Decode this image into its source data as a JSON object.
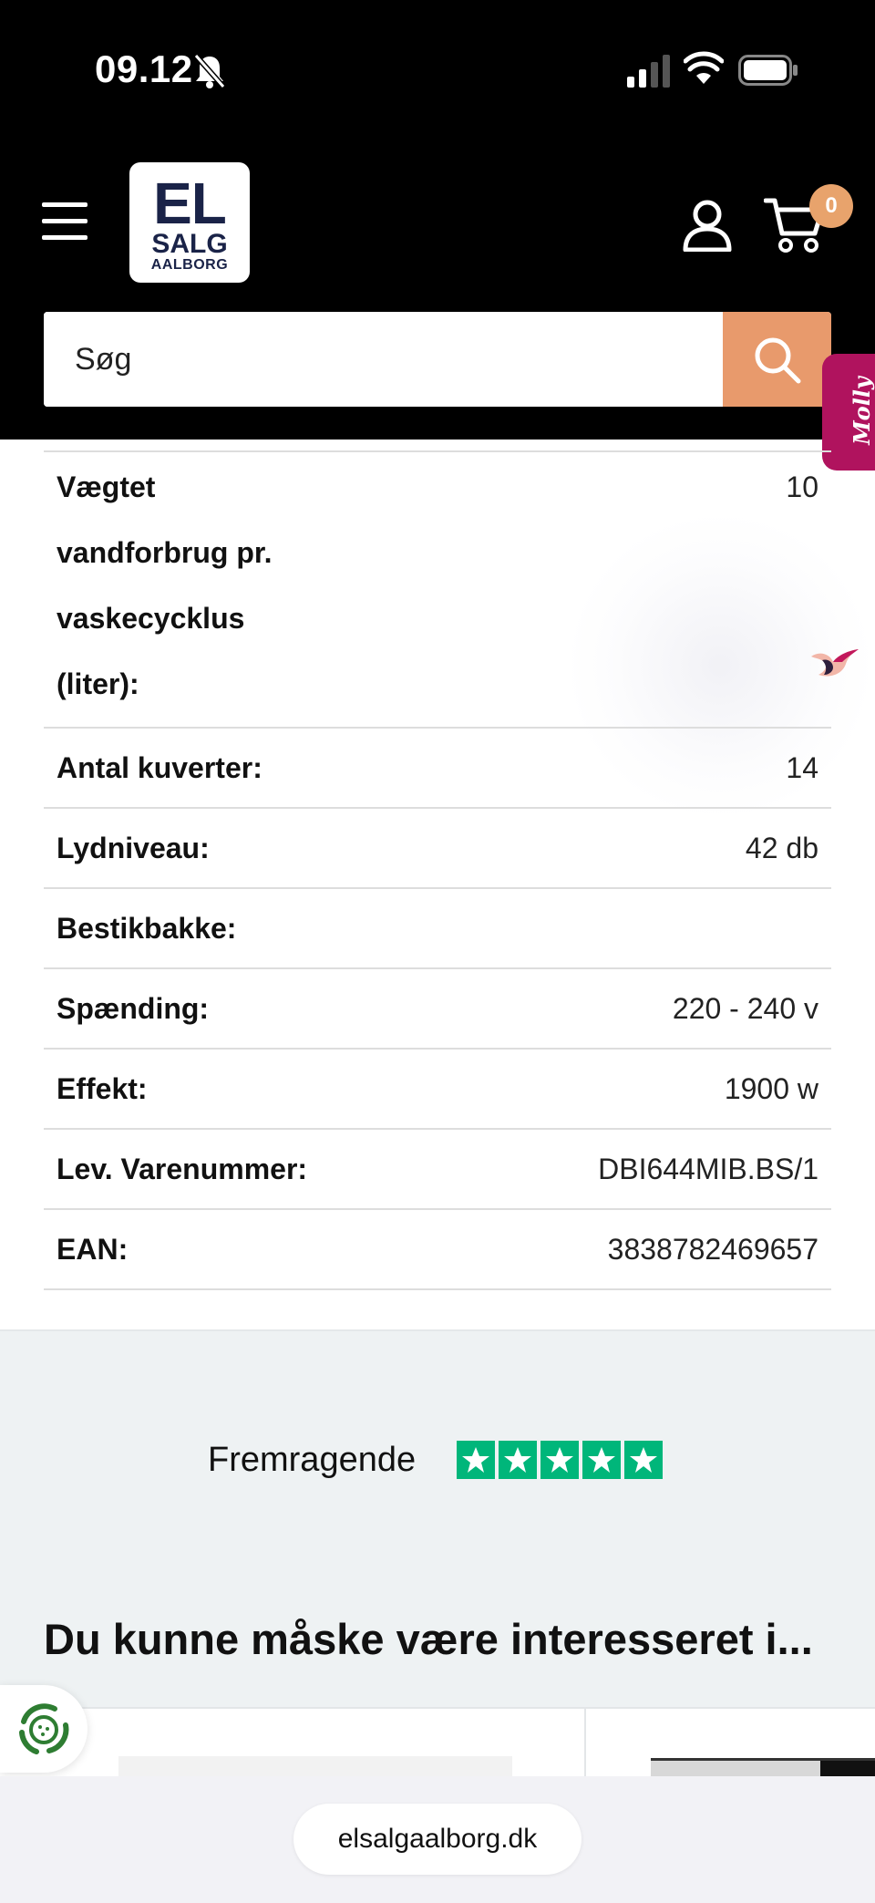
{
  "status_bar": {
    "time": "09.12",
    "icons": [
      "bell-slash-icon",
      "cellular-signal-icon",
      "wifi-icon",
      "battery-icon"
    ]
  },
  "header": {
    "logo": {
      "line1": "EL",
      "line2": "SALG",
      "line3": "AALBORG"
    },
    "cart_count": "0",
    "icons": [
      "menu-icon",
      "account-icon",
      "cart-icon"
    ]
  },
  "search": {
    "placeholder": "Søg",
    "button_icon": "search-icon"
  },
  "molly": {
    "label": "Molly"
  },
  "specs": [
    {
      "label": "Vægtet vandforbrug pr. vaskecycklus (liter):",
      "value": "10"
    },
    {
      "label": "Antal kuverter:",
      "value": "14"
    },
    {
      "label": "Lydniveau:",
      "value": "42 db"
    },
    {
      "label": "Bestikbakke:",
      "value": ""
    },
    {
      "label": "Spænding:",
      "value": "220 - 240 v"
    },
    {
      "label": "Effekt:",
      "value": "1900 w"
    },
    {
      "label": "Lev. Varenummer:",
      "value": "DBI644MIB.BS/1"
    },
    {
      "label": "EAN:",
      "value": "3838782469657"
    }
  ],
  "trustpilot": {
    "label": "Fremragende",
    "stars": 5,
    "star_color": "#00b67a"
  },
  "recommendations": {
    "heading": "Du kunne måske være interesseret i..."
  },
  "browser": {
    "url": "elsalgaalborg.dk"
  },
  "colors": {
    "accent": "#e89a6c",
    "header_bg": "#000000",
    "molly": "#b0135e",
    "logo_text": "#1a2348"
  }
}
